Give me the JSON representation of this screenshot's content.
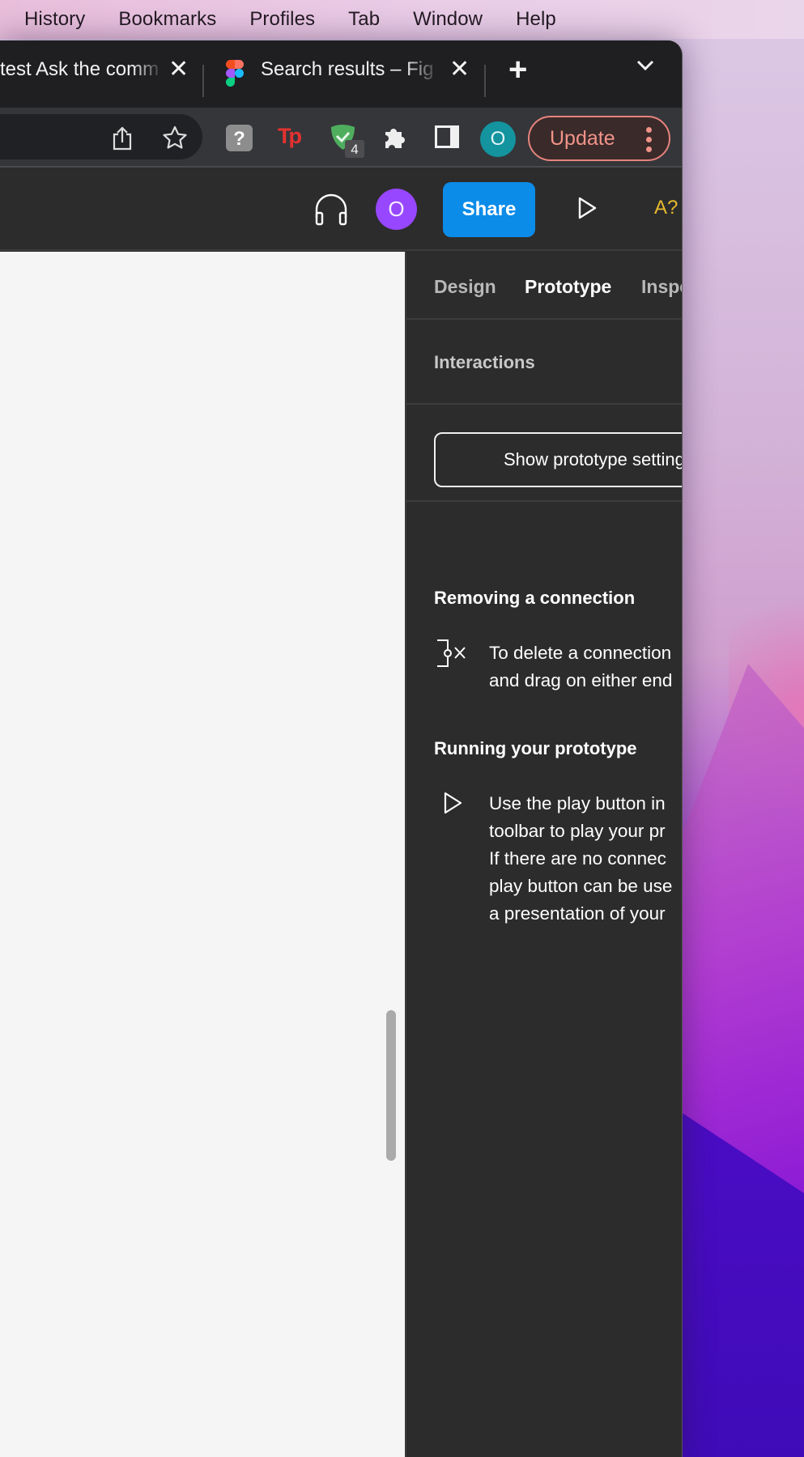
{
  "menubar": {
    "items": [
      "History",
      "Bookmarks",
      "Profiles",
      "Tab",
      "Window",
      "Help"
    ]
  },
  "browser": {
    "tabs": [
      {
        "title": "test Ask the comm",
        "close_icon": "close-icon"
      },
      {
        "title": "Search results – Fig",
        "favicon": "figma-logo-icon",
        "close_icon": "close-icon"
      }
    ],
    "new_tab_icon": "plus-icon",
    "tab_search_icon": "chevron-down-icon",
    "toolbar": {
      "share_icon": "share-icon",
      "bookmark_icon": "star-icon",
      "extensions": [
        {
          "name": "help-extension-icon",
          "glyph": "?"
        },
        {
          "name": "tp-extension-icon",
          "glyph": "Tp"
        },
        {
          "name": "shield-check-extension-icon",
          "badge": "4"
        },
        {
          "name": "puzzle-extensions-icon"
        },
        {
          "name": "side-panel-icon"
        }
      ],
      "profile_initial": "O",
      "update_label": "Update",
      "menu_icon": "kebab-menu-icon"
    }
  },
  "figma_header": {
    "audio_icon": "headphones-icon",
    "user_initial": "O",
    "share_label": "Share",
    "present_icon": "play-icon",
    "font_help_label": "A?"
  },
  "panel": {
    "tabs": [
      {
        "label": "Design",
        "active": false
      },
      {
        "label": "Prototype",
        "active": true
      },
      {
        "label": "Inspect",
        "active": false
      }
    ],
    "interactions_title": "Interactions",
    "show_settings_label": "Show prototype settings",
    "help": [
      {
        "heading": "Removing a connection",
        "icon": "remove-connection-icon",
        "lines": [
          "To delete a connection",
          "and drag on either end"
        ]
      },
      {
        "heading": "Running your prototype",
        "icon": "play-icon",
        "lines": [
          "Use the play button in",
          "toolbar to play your pr",
          "If there are no connec",
          "play button can be use",
          "a presentation of your"
        ]
      }
    ]
  },
  "colors": {
    "share_blue": "#0c8ce9",
    "avatar_purple": "#9747ff",
    "profile_teal": "#13949f",
    "update_salmon": "#f19388",
    "font_help_yellow": "#e8b92e"
  }
}
